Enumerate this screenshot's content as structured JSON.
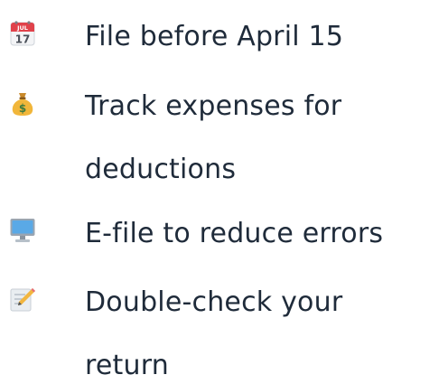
{
  "checklist": {
    "items": [
      {
        "icon": "calendar-icon",
        "lines": [
          "File before April 15"
        ]
      },
      {
        "icon": "money-bag-icon",
        "lines": [
          "Track expenses for",
          "deductions"
        ]
      },
      {
        "icon": "desktop-computer-icon",
        "lines": [
          "E-file to reduce errors"
        ]
      },
      {
        "icon": "memo-pencil-icon",
        "lines": [
          "Double-check your",
          "return"
        ]
      }
    ],
    "calendar_month": "JUL",
    "calendar_day": "17",
    "money_symbol": "$"
  }
}
